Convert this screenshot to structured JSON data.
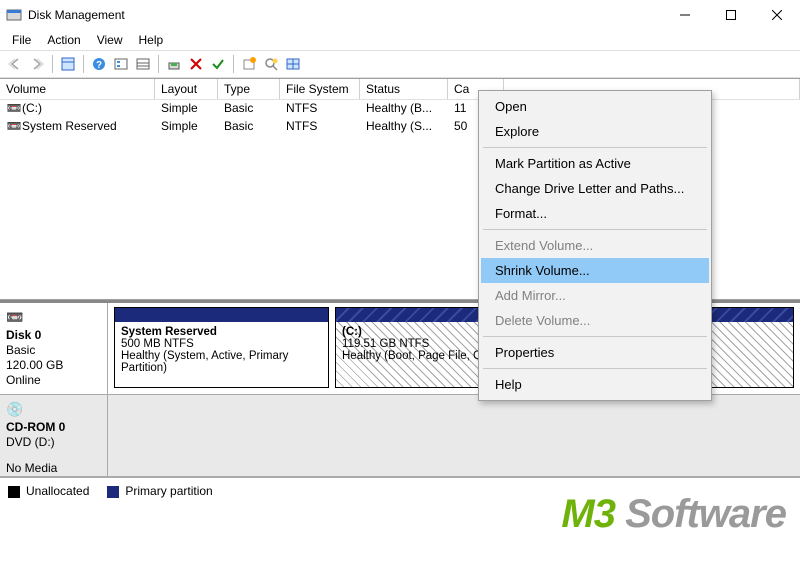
{
  "window": {
    "title": "Disk Management"
  },
  "menu": {
    "file": "File",
    "action": "Action",
    "view": "View",
    "help": "Help"
  },
  "columns": {
    "volume": "Volume",
    "layout": "Layout",
    "type": "Type",
    "filesystem": "File System",
    "status": "Status",
    "capacity": "Ca"
  },
  "volumes": [
    {
      "name": "(C:)",
      "layout": "Simple",
      "type": "Basic",
      "fs": "NTFS",
      "status": "Healthy (B...",
      "capacity": "11"
    },
    {
      "name": "System Reserved",
      "layout": "Simple",
      "type": "Basic",
      "fs": "NTFS",
      "status": "Healthy (S...",
      "capacity": "50"
    }
  ],
  "disks": [
    {
      "name": "Disk 0",
      "type": "Basic",
      "size": "120.00 GB",
      "status": "Online",
      "partitions": [
        {
          "title": "System Reserved",
          "size": "500 MB NTFS",
          "health": "Healthy (System, Active, Primary Partition)",
          "widthpx": 215
        },
        {
          "title": "(C:)",
          "size": "119.51 GB NTFS",
          "health": "Healthy (Boot, Page File, Crash Dump, Primary Partition)",
          "widthpx": 448,
          "hatched": true
        }
      ]
    },
    {
      "name": "CD-ROM 0",
      "type": "DVD (D:)",
      "size": "",
      "status": "No Media",
      "cdrom": true
    }
  ],
  "legend": {
    "unallocated": "Unallocated",
    "primary": "Primary partition"
  },
  "context_menu": {
    "open": "Open",
    "explore": "Explore",
    "mark_active": "Mark Partition as Active",
    "change_letter": "Change Drive Letter and Paths...",
    "format": "Format...",
    "extend": "Extend Volume...",
    "shrink": "Shrink Volume...",
    "add_mirror": "Add Mirror...",
    "delete": "Delete Volume...",
    "properties": "Properties",
    "help": "Help"
  },
  "watermark": {
    "m3": "M3",
    "rest": " Software"
  }
}
